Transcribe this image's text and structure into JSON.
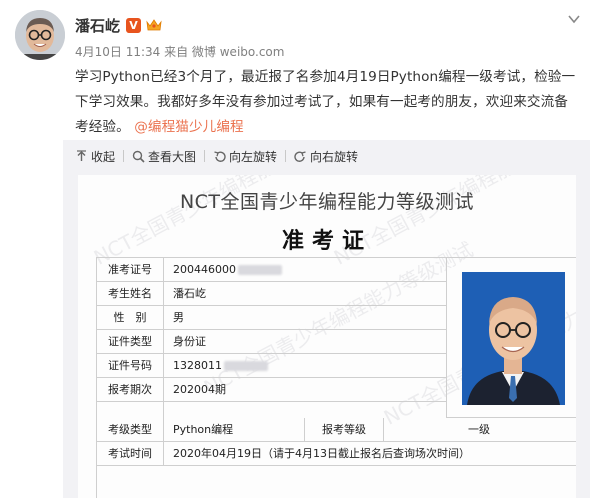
{
  "post": {
    "author": "潘石屹",
    "verified_badge": "V",
    "meta": "4月10日 11:34 来自 微博 weibo.com",
    "text": "学习Python已经3个月了，最近报了名参加4月19日Python编程一级考试，检验一下学习效果。我都好多年没有参加过考试了，如果有一起考的朋友，欢迎来交流备考经验。",
    "mention": "@编程猫少儿编程"
  },
  "toolbar": {
    "collapse": "收起",
    "view_large": "查看大图",
    "rotate_left": "向左旋转",
    "rotate_right": "向右旋转"
  },
  "ticket": {
    "title": "NCT全国青少年编程能力等级测试",
    "subtitle": "准考证",
    "watermark": "NCT全国青少年编程能力等级测试",
    "rows": [
      {
        "label": "准考证号",
        "value": "200446000"
      },
      {
        "label": "考生姓名",
        "value": "潘石屹"
      },
      {
        "label": "性　别",
        "value": "男"
      },
      {
        "label": "证件类型",
        "value": "身份证"
      },
      {
        "label": "证件号码",
        "value": "1328011"
      },
      {
        "label": "报考期次",
        "value": "202004期"
      },
      {
        "label": "考级类型",
        "value": "Python编程",
        "label2": "报考等级",
        "value2": "一级"
      },
      {
        "label": "考试时间",
        "value": "2020年04月19日（请于4月13日截止报名后查询场次时间）"
      }
    ]
  },
  "icons": {
    "collapse": "arrow-up-icon",
    "view_large": "zoom-icon",
    "rotate_left": "rotate-left-icon",
    "rotate_right": "rotate-right-icon",
    "caret": "chevron-down-icon",
    "crown": "crown-icon"
  },
  "colors": {
    "mention": "#eb7350",
    "verified": "#e8541e",
    "photo_bg": "#1e5fb5",
    "media_bg": "#f2f2f5"
  }
}
